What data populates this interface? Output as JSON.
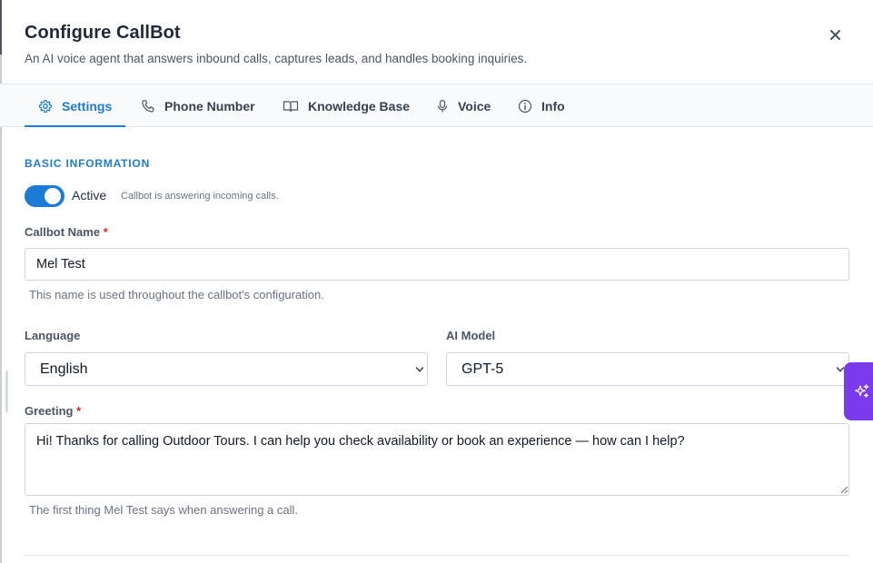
{
  "header": {
    "title": "Configure CallBot",
    "subtitle": "An AI voice agent that answers inbound calls, captures leads, and handles booking inquiries."
  },
  "tabs": [
    {
      "label": "Settings",
      "icon": "gear-icon",
      "active": true
    },
    {
      "label": "Phone Number",
      "icon": "phone-icon",
      "active": false
    },
    {
      "label": "Knowledge Base",
      "icon": "book-icon",
      "active": false
    },
    {
      "label": "Voice",
      "icon": "microphone-icon",
      "active": false
    },
    {
      "label": "Info",
      "icon": "info-icon",
      "active": false
    }
  ],
  "basic_info": {
    "section_title": "BASIC INFORMATION",
    "active_toggle": {
      "label": "Active",
      "description": "Callbot is answering incoming calls.",
      "on": true
    },
    "name": {
      "label": "Callbot Name",
      "required_mark": "*",
      "value": "Mel Test",
      "help": "This name is used throughout the callbot's configuration."
    },
    "language": {
      "label": "Language",
      "value": "English"
    },
    "ai_model": {
      "label": "AI Model",
      "value": "GPT-5"
    },
    "greeting": {
      "label": "Greeting",
      "required_mark": "*",
      "value": "Hi! Thanks for calling Outdoor Tours. I can help you check availability or book an experience — how can I help?",
      "help": "The first thing Mel Test says when answering a call."
    }
  },
  "colors": {
    "accent": "#1d7bd8",
    "ai_button": "#7c3aed",
    "required": "#dc2626"
  }
}
